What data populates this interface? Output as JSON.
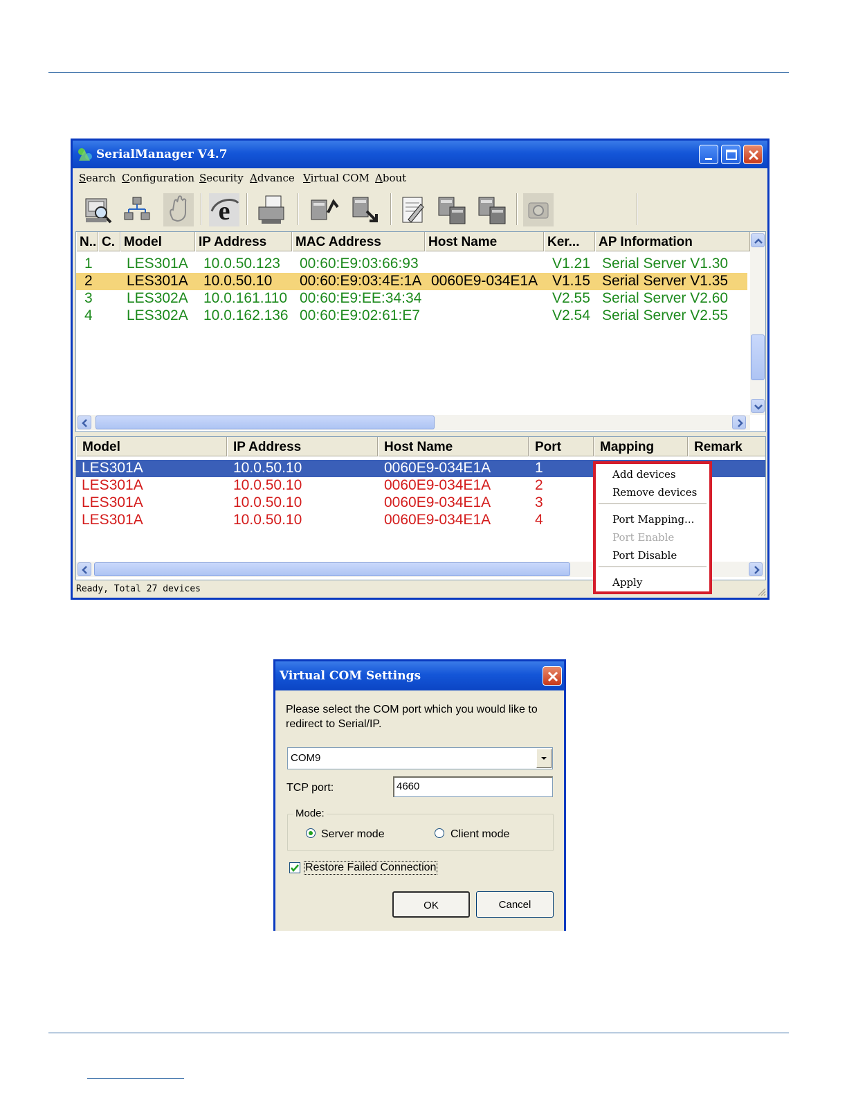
{
  "window": {
    "title": "SerialManager V4.7",
    "menu": [
      "Search",
      "Configuration",
      "Security",
      "Advance",
      "Virtual COM",
      "About"
    ],
    "toolbar_icons": [
      "search-device-icon",
      "network-icon",
      "hand-icon",
      "internet-explorer-icon",
      "printer-icon",
      "server-upload-icon",
      "server-download-icon",
      "document-edit-icon",
      "server-connect-icon",
      "server-disconnect-icon",
      "camera-icon"
    ]
  },
  "device_table": {
    "headers": [
      "N..",
      "C.",
      "Model",
      "IP Address",
      "MAC Address",
      "Host Name",
      "Ker...",
      "AP Information"
    ],
    "rows": [
      {
        "n": "1",
        "model": "LES301A",
        "ip": "10.0.50.123",
        "mac": "00:60:E9:03:66:93",
        "host": "",
        "kernel": "V1.21",
        "ap": "Serial Server V1.30"
      },
      {
        "n": "2",
        "model": "LES301A",
        "ip": "10.0.50.10",
        "mac": "00:60:E9:03:4E:1A",
        "host": "0060E9-034E1A",
        "kernel": "V1.15",
        "ap": "Serial Server V1.35"
      },
      {
        "n": "3",
        "model": "LES302A",
        "ip": "10.0.161.110",
        "mac": "00:60:E9:EE:34:34",
        "host": "",
        "kernel": "V2.55",
        "ap": "Serial Server V2.60"
      },
      {
        "n": "4",
        "model": "LES302A",
        "ip": "10.0.162.136",
        "mac": "00:60:E9:02:61:E7",
        "host": "",
        "kernel": "V2.54",
        "ap": "Serial Server V2.55"
      }
    ]
  },
  "port_table": {
    "headers": [
      "Model",
      "IP Address",
      "Host Name",
      "Port",
      "Mapping",
      "Remark"
    ],
    "rows": [
      {
        "model": "LES301A",
        "ip": "10.0.50.10",
        "host": "0060E9-034E1A",
        "port": "1"
      },
      {
        "model": "LES301A",
        "ip": "10.0.50.10",
        "host": "0060E9-034E1A",
        "port": "2"
      },
      {
        "model": "LES301A",
        "ip": "10.0.50.10",
        "host": "0060E9-034E1A",
        "port": "3"
      },
      {
        "model": "LES301A",
        "ip": "10.0.50.10",
        "host": "0060E9-034E1A",
        "port": "4"
      }
    ]
  },
  "context_menu": {
    "items": [
      "Add devices",
      "Remove devices",
      "Port Mapping...",
      "Port Enable",
      "Port Disable",
      "Apply"
    ]
  },
  "status": "Ready, Total 27 devices",
  "dialog": {
    "title": "Virtual COM Settings",
    "prompt_line1": "Please select the COM port which you  would like to",
    "prompt_line2": "redirect to Serial/IP.",
    "com_port": "COM9",
    "tcp_label": "TCP port:",
    "tcp_value": "4660",
    "mode_label": "Mode:",
    "server_mode": "Server mode",
    "client_mode": "Client mode",
    "selected_mode": "Server mode",
    "restore_label": "Restore Failed Connection",
    "restore_checked": true,
    "ok": "OK",
    "cancel": "Cancel"
  },
  "colors": {
    "titlebar": "#0b45c4",
    "green_row": "#1d8a1d",
    "highlight_row": "#f5d57a",
    "red_row": "#d41c1c",
    "selected_row": "#3a5fb8",
    "context_border": "#d51d2b",
    "page_rule": "#3a6fa8"
  }
}
